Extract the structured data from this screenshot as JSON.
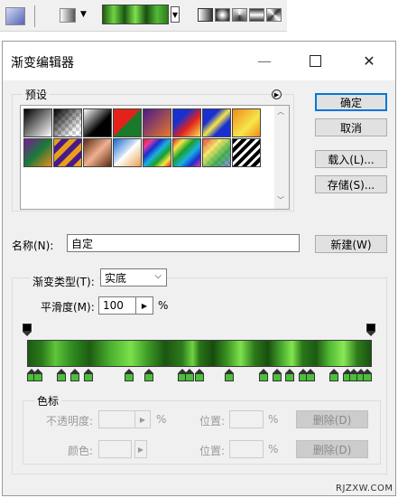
{
  "colors": {
    "accent": "#0078d7",
    "stop_green": "#4cbf3a"
  },
  "dialog": {
    "title": "渐变编辑器",
    "controls": {
      "minimize": "—",
      "maximize": "☐",
      "close": "✕"
    }
  },
  "presets": {
    "label": "预设",
    "swatches_row1": [
      "black-white",
      "transparent-checker",
      "black-white-2",
      "red-green",
      "violet-orange",
      "blue-red-yellow",
      "blue-yellow-blue",
      "orange-yellow"
    ],
    "swatches_row2": [
      "violet-green-orange",
      "yellow-violet-stripes",
      "copper",
      "chrome",
      "spectrum-diagonal",
      "rainbow",
      "rainbow-transparent",
      "black-white-stripes"
    ]
  },
  "buttons": {
    "ok": "确定",
    "cancel": "取消",
    "load": "载入(L)...",
    "save": "存储(S)...",
    "new": "新建(W)"
  },
  "name": {
    "label": "名称(N):",
    "value": "自定"
  },
  "gradient_type": {
    "label": "渐变类型(T):",
    "value": "实底"
  },
  "smoothness": {
    "label": "平滑度(M):",
    "value": "100",
    "unit": "%"
  },
  "stops": {
    "count_color": 24,
    "color_positions": [
      0.0,
      0.02,
      0.09,
      0.13,
      0.17,
      0.29,
      0.35,
      0.45,
      0.47,
      0.5,
      0.59,
      0.69,
      0.73,
      0.77,
      0.81,
      0.83,
      0.9,
      0.94,
      0.96,
      0.98,
      1.0
    ],
    "opacity_positions": [
      0.0,
      1.0
    ]
  },
  "color_stops_group": {
    "label": "色标",
    "opacity_label": "不透明度:",
    "opacity_unit": "%",
    "location_label": "位置:",
    "location_unit": "%",
    "color_label": "颜色:",
    "delete_label": "删除(D)"
  },
  "watermark": "RJZXW.COM"
}
